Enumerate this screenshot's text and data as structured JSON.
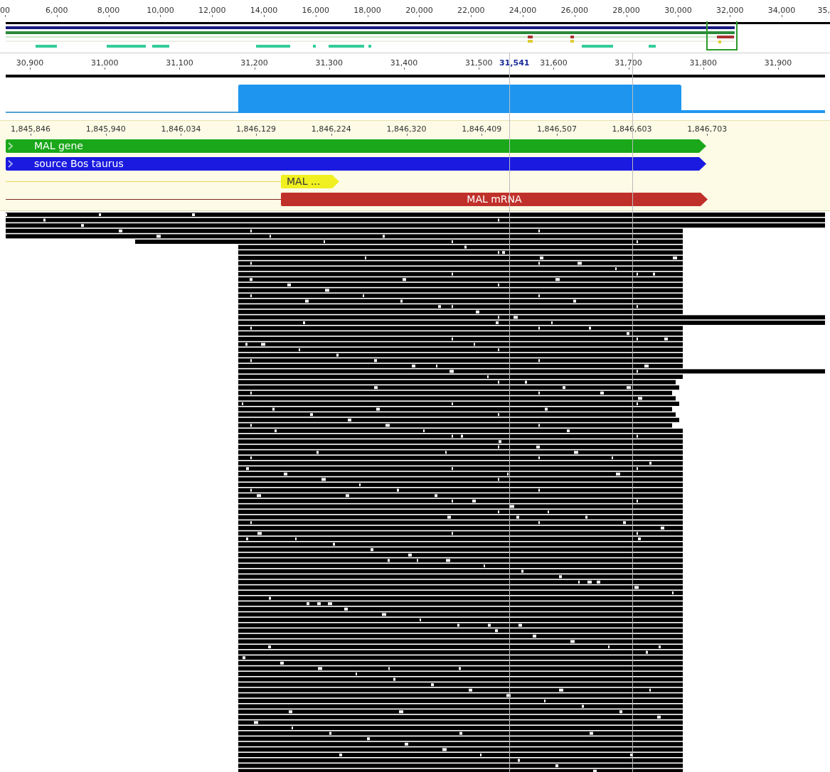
{
  "overview_ruler": {
    "ticks": [
      "00",
      "6,000",
      "8,000",
      "10,000",
      "12,000",
      "14,000",
      "16,000",
      "18,000",
      "20,000",
      "22,000",
      "24,000",
      "26,000",
      "28,000",
      "30,000",
      "32,000",
      "34,000",
      "35,"
    ]
  },
  "detail_ruler": {
    "ticks": [
      "30,900",
      "31,000",
      "31,100",
      "31,200",
      "31,300",
      "31,400",
      "31,500",
      "31,600",
      "31,700",
      "31,800",
      "31,900"
    ],
    "cursor": "31,541"
  },
  "sequence_ruler": {
    "ticks": [
      "1,845,846",
      "1,845,940",
      "1,846,034",
      "1,846,129",
      "1,846,224",
      "1,846,320",
      "1,846,409",
      "1,846,507",
      "1,846,603",
      "1,846,703"
    ]
  },
  "annotations": [
    {
      "label": "MAL gene",
      "color": "#1aa81a",
      "kind": "gene"
    },
    {
      "label": "source Bos taurus",
      "color": "#1a1ae0",
      "kind": "source"
    },
    {
      "label": "MAL ...",
      "color": "#f0f020",
      "kind": "cds"
    },
    {
      "label": "MAL mRNA",
      "color": "#c0302a",
      "kind": "mrna"
    }
  ]
}
